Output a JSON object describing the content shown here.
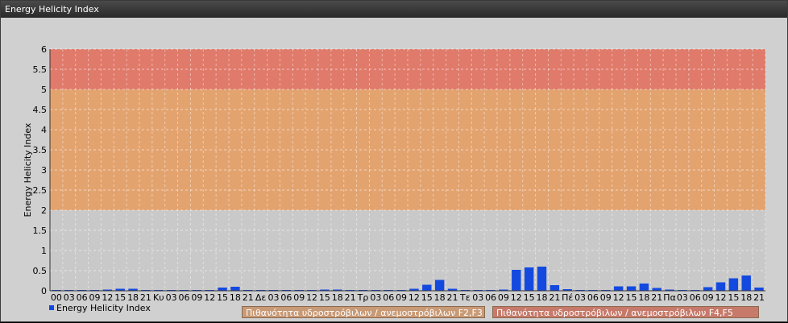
{
  "window": {
    "title": "Energy Helicity Index"
  },
  "colors": {
    "bar": "#1449e0",
    "band_high": "#e07a6a",
    "band_mid": "#e3a36f",
    "band_low": "#c9c9c9",
    "legend_f2f3": "#c99a76",
    "legend_f4f5": "#c77a6a"
  },
  "chart_data": {
    "type": "bar",
    "title": "",
    "ylabel": "Energy Helicity Index",
    "xlabel": "",
    "ylim": [
      0,
      6
    ],
    "yticks": [
      "0",
      "0.5",
      "1",
      "1.5",
      "2",
      "2.5",
      "3",
      "3.5",
      "4",
      "4.5",
      "5",
      "5.5",
      "6"
    ],
    "grid": true,
    "legend_placement": "bottom-left",
    "bands": [
      {
        "from": 0,
        "to": 2,
        "color": "#c9c9c9"
      },
      {
        "from": 2,
        "to": 5,
        "color": "#e3a36f"
      },
      {
        "from": 5,
        "to": 6,
        "color": "#e07a6a"
      }
    ],
    "categories": [
      "00",
      "03",
      "06",
      "09",
      "12",
      "15",
      "18",
      "21",
      "Κυ",
      "03",
      "06",
      "09",
      "12",
      "15",
      "18",
      "21",
      "Δε",
      "03",
      "06",
      "09",
      "12",
      "15",
      "18",
      "21",
      "Τρ",
      "03",
      "06",
      "09",
      "12",
      "15",
      "18",
      "21",
      "Τε",
      "03",
      "06",
      "09",
      "12",
      "15",
      "18",
      "21",
      "Πέ",
      "03",
      "06",
      "09",
      "12",
      "15",
      "18",
      "21",
      "Πα",
      "03",
      "06",
      "09",
      "12",
      "15",
      "18",
      "21"
    ],
    "series": [
      {
        "name": "Energy Helicity Index",
        "values": [
          0.02,
          0.02,
          0.02,
          0.02,
          0.03,
          0.05,
          0.05,
          0.02,
          0.02,
          0.02,
          0.02,
          0.02,
          0.02,
          0.08,
          0.1,
          0.02,
          0.02,
          0.02,
          0.02,
          0.02,
          0.02,
          0.03,
          0.03,
          0.02,
          0.02,
          0.02,
          0.02,
          0.02,
          0.05,
          0.15,
          0.27,
          0.05,
          0.02,
          0.02,
          0.02,
          0.03,
          0.52,
          0.58,
          0.6,
          0.14,
          0.04,
          0.02,
          0.02,
          0.02,
          0.11,
          0.11,
          0.18,
          0.07,
          0.03,
          0.02,
          0.02,
          0.09,
          0.21,
          0.31,
          0.38,
          0.08
        ]
      }
    ],
    "legend_labels": {
      "f2f3": "Πιθανότητα υδροστρόβιλων / ανεμοστρόβιλων F2,F3",
      "f4f5": "Πιθανότητα υδροστρόβιλων / ανεμοστρόβιλων F4,F5"
    }
  }
}
